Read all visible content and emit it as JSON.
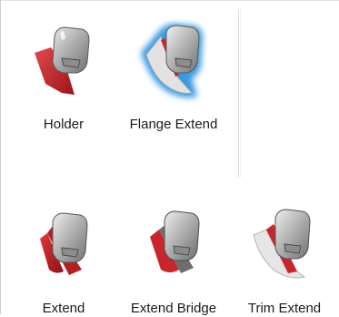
{
  "tools": [
    {
      "label": "Holder",
      "selected": false,
      "variant": "holder"
    },
    {
      "label": "Flange Extend",
      "selected": true,
      "variant": "flange"
    },
    {
      "label": "Extend",
      "selected": false,
      "variant": "extend"
    },
    {
      "label": "Extend Bridge",
      "selected": false,
      "variant": "bridge"
    },
    {
      "label": "Trim Extend",
      "selected": false,
      "variant": "trim"
    }
  ],
  "colors": {
    "selection_glow": "#3aa0e8",
    "red_part": "#c8262b",
    "metal": "#b8b8b8",
    "label_text": "#1a1a1a"
  }
}
